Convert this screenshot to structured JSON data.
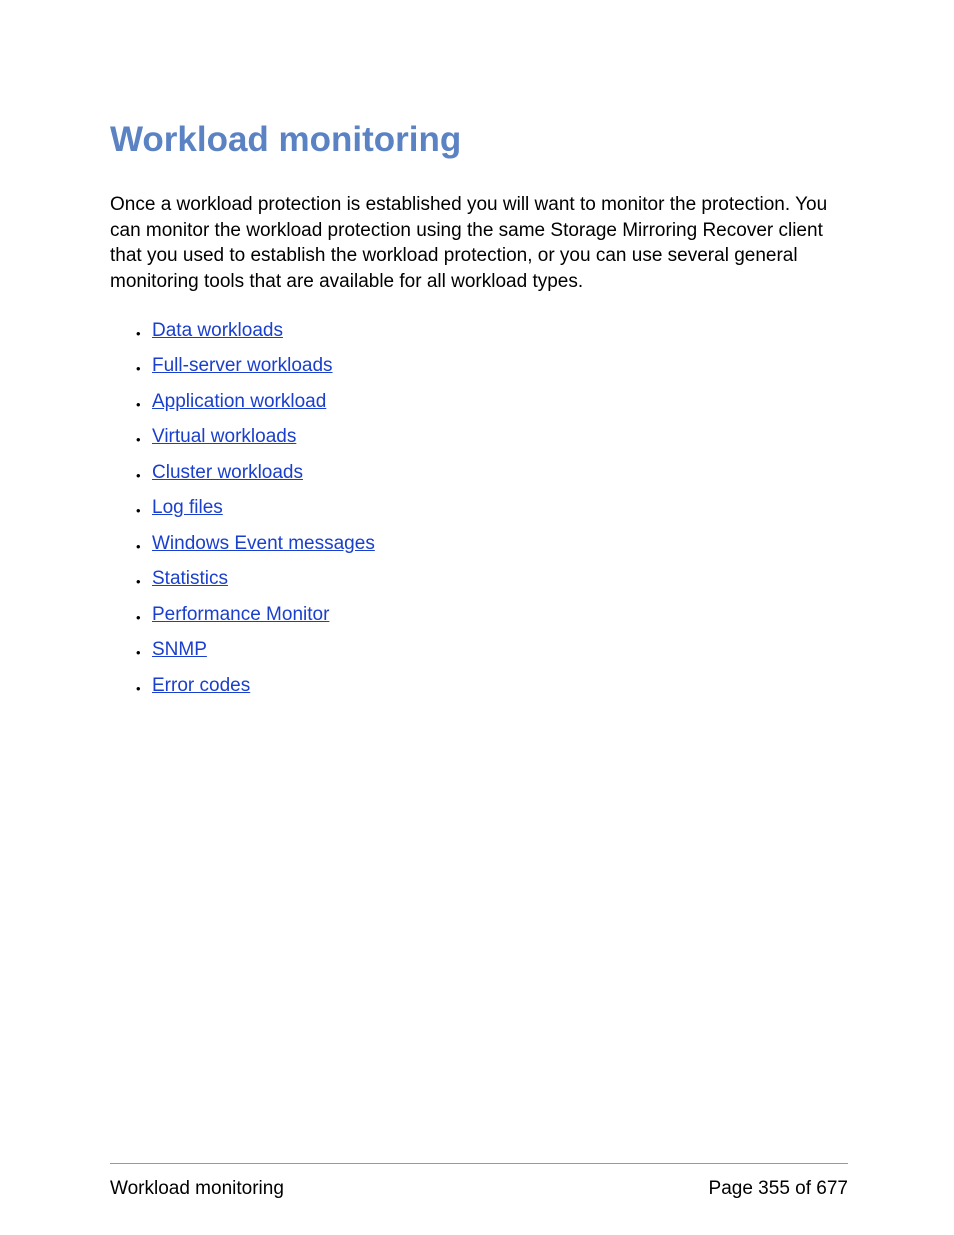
{
  "title": "Workload monitoring",
  "intro": "Once a workload protection is established you will want to monitor the protection. You can monitor the workload protection using the same Storage Mirroring Recover client that you used to establish the workload protection, or you can use several general monitoring tools that are available for all workload types.",
  "links": [
    "Data workloads",
    "Full-server workloads",
    "Application workload",
    "Virtual workloads",
    "Cluster workloads",
    "Log files",
    "Windows Event messages",
    "Statistics",
    "Performance Monitor",
    "SNMP",
    "Error codes"
  ],
  "footer": {
    "section": "Workload monitoring",
    "page": "Page 355 of 677"
  }
}
